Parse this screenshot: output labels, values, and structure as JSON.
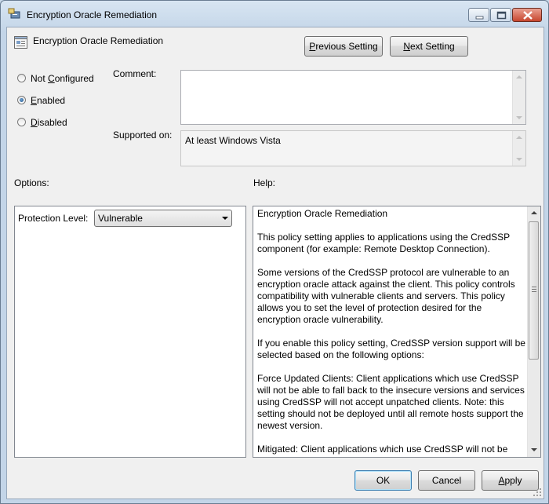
{
  "window": {
    "title": "Encryption Oracle Remediation"
  },
  "header": {
    "title": "Encryption Oracle Remediation",
    "previous_button": {
      "pre": "",
      "key": "P",
      "post": "revious Setting"
    },
    "next_button": {
      "pre": "",
      "key": "N",
      "post": "ext Setting"
    }
  },
  "radios": [
    {
      "pre": "Not ",
      "key": "C",
      "post": "onfigured",
      "selected": false
    },
    {
      "pre": "",
      "key": "E",
      "post": "nabled",
      "selected": true
    },
    {
      "pre": "",
      "key": "D",
      "post": "isabled",
      "selected": false
    }
  ],
  "comment": {
    "label": "Comment:",
    "value": ""
  },
  "supported": {
    "label": "Supported on:",
    "value": "At least Windows Vista"
  },
  "options": {
    "label": "Options:",
    "protection_label": "Protection Level:",
    "protection_value": "Vulnerable"
  },
  "help": {
    "label": "Help:",
    "paragraphs": [
      "Encryption Oracle Remediation",
      "This policy setting applies to applications using the CredSSP component (for example: Remote Desktop Connection).",
      "Some versions of the CredSSP protocol are vulnerable to an encryption oracle attack against the client.  This policy controls compatibility with vulnerable clients and servers.  This policy allows you to set the level of protection desired for the encryption oracle vulnerability.",
      "If you enable this policy setting, CredSSP version support will be selected based on the following options:",
      "Force Updated Clients: Client applications which use CredSSP will not be able to fall back to the insecure versions and services using CredSSP will not accept unpatched clients. Note: this setting should not be deployed until all remote hosts support the newest version.",
      "Mitigated: Client applications which use CredSSP will not be able to fall back to the insecure version but services using CredSSP will accept unpatched clients."
    ]
  },
  "footer": {
    "ok": "OK",
    "cancel": "Cancel",
    "apply": {
      "pre": "",
      "key": "A",
      "post": "pply"
    }
  }
}
